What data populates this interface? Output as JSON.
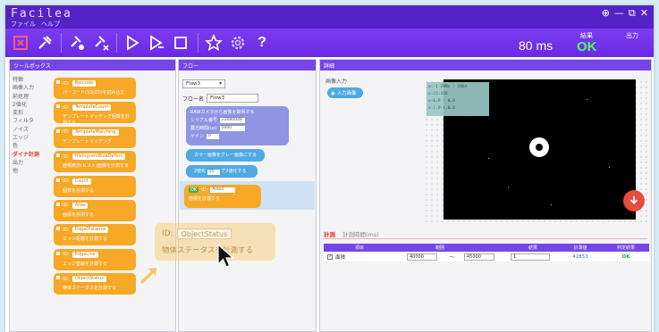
{
  "app": {
    "title": "Facilea",
    "menu": [
      "ファイル",
      "ヘルプ"
    ],
    "window_controls": [
      "⊕",
      "—",
      "⧉",
      "✕"
    ]
  },
  "toolbar": {
    "icons": [
      "capture-icon",
      "tool-icon",
      "tool-ok-icon",
      "tool-ng-icon",
      "play-icon",
      "play-step-icon",
      "stop-icon",
      "star-icon",
      "gear-icon",
      "help-icon"
    ],
    "time": "80 ms",
    "judge_label": "結果",
    "judge_value": "OK",
    "output_label": "出力"
  },
  "toolbox": {
    "header": "ツールボックス",
    "categories": [
      "特徴",
      "画像入力",
      "前処理",
      "2値化",
      "変形",
      "フィルタ",
      "ノイズ",
      "エッジ",
      "色",
      "ダイナ計測",
      "出力",
      "他"
    ],
    "active_category_index": 9,
    "blocks": [
      {
        "id": "Barcode",
        "desc": "バーコード(1D/2D)を読み込む"
      },
      {
        "id": "TemplateCount",
        "desc": "テンプレートマッチング個数を計測する"
      },
      {
        "id": "TemplateMatching",
        "desc": "テンプレートマッチング"
      },
      {
        "id": "HistogramBlobDefect",
        "desc": "面積統計(ヒスト)面積を計測する"
      },
      {
        "id": "Count",
        "desc": "個数を計測する"
      },
      {
        "id": "Area",
        "desc": "面積を計測する"
      },
      {
        "id": "EdgeDistance",
        "desc": "エッジ距離を計測する"
      },
      {
        "id": "EdgeLine",
        "desc": "エッジ直線を計測する"
      },
      {
        "id": "ObjectStatus",
        "desc": "物体ステータスを計測する"
      }
    ]
  },
  "flow": {
    "header": "フロー",
    "selector": "Flow3",
    "name_label": "フロー名",
    "name_value": "Flow3",
    "camera": {
      "title": "RAWカメラから画像を取得する",
      "fields": [
        {
          "label": "シリアル番号",
          "value": "22080048"
        },
        {
          "label": "露光時間(us)",
          "value": "5000"
        },
        {
          "label": "ゲイン",
          "value": "0"
        }
      ]
    },
    "convert": "カラー画像をグレー画像にする",
    "binarize_label": "2値化",
    "binarize_value": "55",
    "binarize_suffix": "で2値化する",
    "area": {
      "ok": "OK",
      "id": "Area1",
      "desc": "面積を計測する"
    }
  },
  "drag": {
    "id_label": "ID:",
    "id_value": "ObjectStatus",
    "desc": "物体ステータスを計測する"
  },
  "detail": {
    "header": "詳細",
    "input_label": "画像入力",
    "input_chip": "入力画像",
    "coords": [
      "x:-1 298x : 1664",
      "c:(5:426",
      "x:6,9 : 0,0",
      "x:(,9:(,0,0"
    ],
    "tabs": [
      "計測",
      "計測時間(ms)"
    ],
    "columns": [
      "項目",
      "範囲",
      "",
      "",
      "結果",
      "計測値",
      "判定結果"
    ],
    "rows": [
      {
        "checked": true,
        "name": "面積",
        "min": "40000",
        "sep": "〜",
        "max": "45000",
        "n": "1",
        "value": "42853",
        "judge": "OK"
      }
    ]
  }
}
